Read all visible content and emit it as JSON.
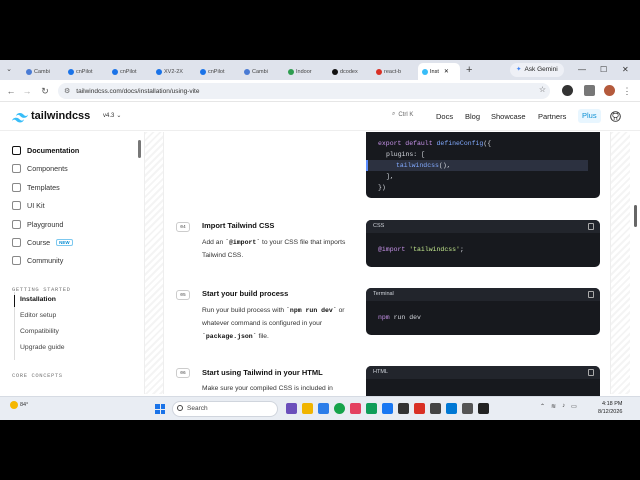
{
  "browser": {
    "tabs": [
      {
        "label": "Cambi",
        "color": "#4a7bd4"
      },
      {
        "label": "cnPilot",
        "color": "#1a73e8"
      },
      {
        "label": "cnPilot",
        "color": "#1a73e8"
      },
      {
        "label": "XV2-2X",
        "color": "#1a73e8"
      },
      {
        "label": "cnPilot",
        "color": "#1a73e8"
      },
      {
        "label": "Cambi",
        "color": "#4a7bd4"
      },
      {
        "label": "Indoor",
        "color": "#2e9d4f"
      },
      {
        "label": "dcodex",
        "color": "#111111"
      },
      {
        "label": "react-b",
        "color": "#d93025"
      },
      {
        "label": "Inst",
        "color": "#38bdf8"
      }
    ],
    "new_tab": "+",
    "ask_gemini": "Ask Gemini",
    "win_min": "—",
    "win_max": "☐",
    "win_close": "✕",
    "url": "tailwindcss.com/docs/installation/using-vite"
  },
  "site": {
    "logo": "tailwindcss",
    "version": "v4.3",
    "search_shortcut": "Ctrl K",
    "nav": [
      "Docs",
      "Blog",
      "Showcase",
      "Partners"
    ],
    "plus": "Plus"
  },
  "sidebar": {
    "main": [
      {
        "label": "Documentation",
        "active": true
      },
      {
        "label": "Components"
      },
      {
        "label": "Templates"
      },
      {
        "label": "UI Kit"
      },
      {
        "label": "Playground"
      },
      {
        "label": "Course",
        "badge": "NEW"
      },
      {
        "label": "Community"
      }
    ],
    "section_getting_started": "GETTING STARTED",
    "getting_started": [
      "Installation",
      "Editor setup",
      "Compatibility",
      "Upgrade guide"
    ],
    "section_core": "CORE CONCEPTS"
  },
  "steps": [
    {
      "num": "04",
      "title": "Import Tailwind CSS",
      "text_a": "Add an ",
      "code_a": "`@import`",
      "text_b": " to your CSS file that imports Tailwind CSS."
    },
    {
      "num": "05",
      "title": "Start your build process",
      "text_a": "Run your build process with ",
      "code_a": "`npm run dev`",
      "text_b": " or whatever command is configured in your ",
      "code_b": "`package.json`",
      "text_c": " file."
    },
    {
      "num": "06",
      "title": "Start using Tailwind in your HTML",
      "text_a": "Make sure your compiled CSS is included in"
    }
  ],
  "code": {
    "vite": {
      "line1_kw": "export default ",
      "line1_fn": "defineConfig",
      "line1_end": "({",
      "line2": "plugins: [",
      "line3_fn": "tailwindcss",
      "line3_end": "(),",
      "line4": "],",
      "line5": "})"
    },
    "css": {
      "label": "CSS",
      "kw": "@import ",
      "str": "'tailwindcss'",
      "end": ";"
    },
    "terminal": {
      "label": "Terminal",
      "cmd": "npm",
      "rest": " run dev"
    },
    "html": {
      "label": "HTML"
    }
  },
  "taskbar": {
    "weather": "84°",
    "search": "Search",
    "time": "4:18 PM",
    "date": "8/12/2026"
  }
}
